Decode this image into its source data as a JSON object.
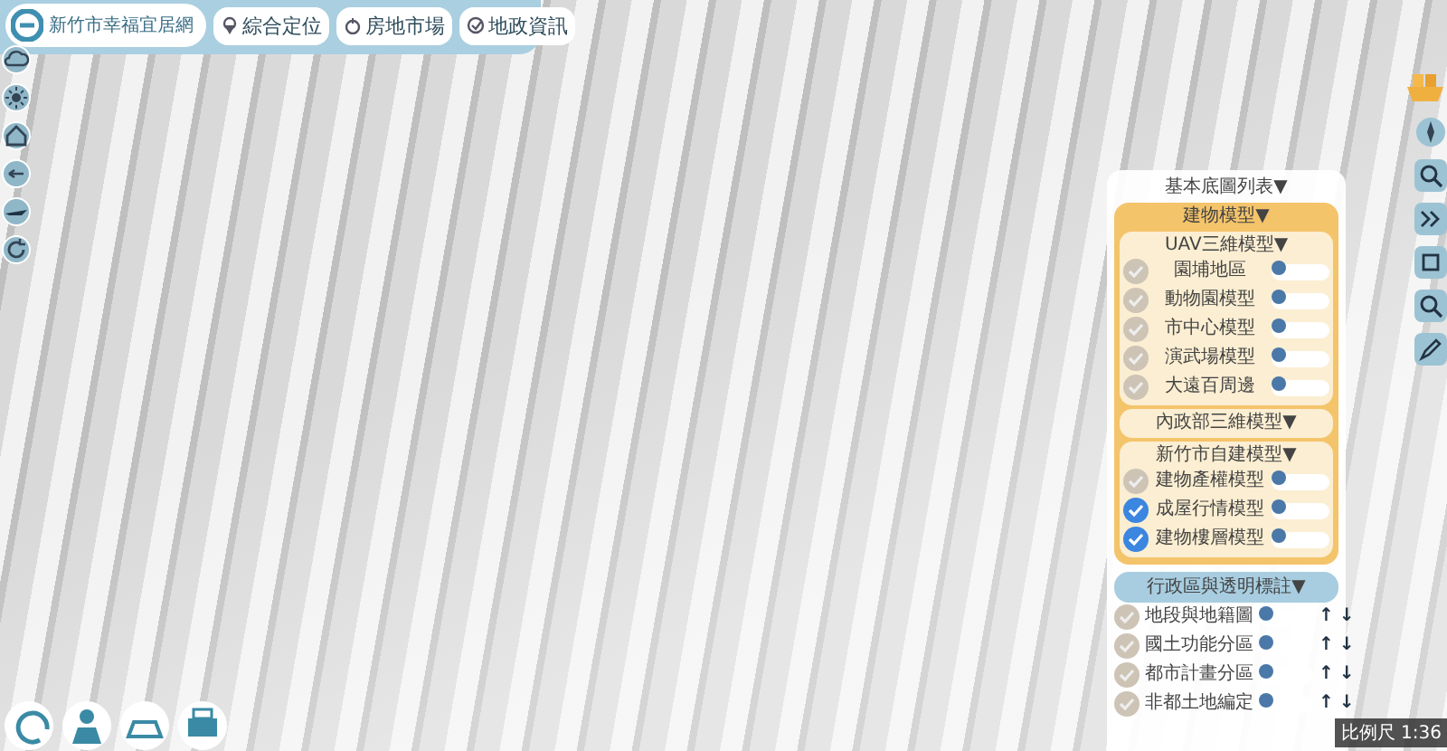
{
  "header": {
    "site_title": "新竹市幸福宜居網",
    "menu": [
      {
        "label": "綜合定位"
      },
      {
        "label": "房地市場"
      },
      {
        "label": "地政資訊"
      }
    ]
  },
  "layer_panel": {
    "title": "基本底圖列表▼",
    "groups": [
      {
        "title": "建物模型▼",
        "subgroups": [
          {
            "title": "UAV三維模型▼",
            "layers": [
              {
                "name": "園埔地區",
                "checked": false,
                "level": 0
              },
              {
                "name": "動物園模型",
                "checked": false,
                "level": 0
              },
              {
                "name": "市中心模型",
                "checked": false,
                "level": 0
              },
              {
                "name": "演武場模型",
                "checked": false,
                "level": 0
              },
              {
                "name": "大遠百周邊",
                "checked": false,
                "level": 0
              }
            ]
          },
          {
            "title": "內政部三維模型▼"
          },
          {
            "title": "新竹市自建模型▼",
            "layers": [
              {
                "name": "建物產權模型",
                "checked": false,
                "level": 0
              },
              {
                "name": "成屋行情模型",
                "checked": true,
                "level": 0
              },
              {
                "name": "建物樓層模型",
                "checked": true,
                "level": 0
              }
            ]
          }
        ]
      }
    ],
    "overlay_group": {
      "title": "行政區與透明標註▼",
      "layers": [
        {
          "name": "地段與地籍圖",
          "checked": false,
          "level": 0,
          "move_up": "↑",
          "move_down": "↓"
        },
        {
          "name": "國土功能分區",
          "checked": false,
          "level": 0,
          "move_up": "↑",
          "move_down": "↓"
        },
        {
          "name": "都市計畫分區",
          "checked": false,
          "level": 0,
          "move_up": "↑",
          "move_down": "↓"
        },
        {
          "name": "非都土地編定",
          "checked": false,
          "level": 0,
          "move_up": "↑",
          "move_down": "↓"
        }
      ]
    }
  },
  "scale_bar": {
    "label": "比例尺 1:36"
  }
}
